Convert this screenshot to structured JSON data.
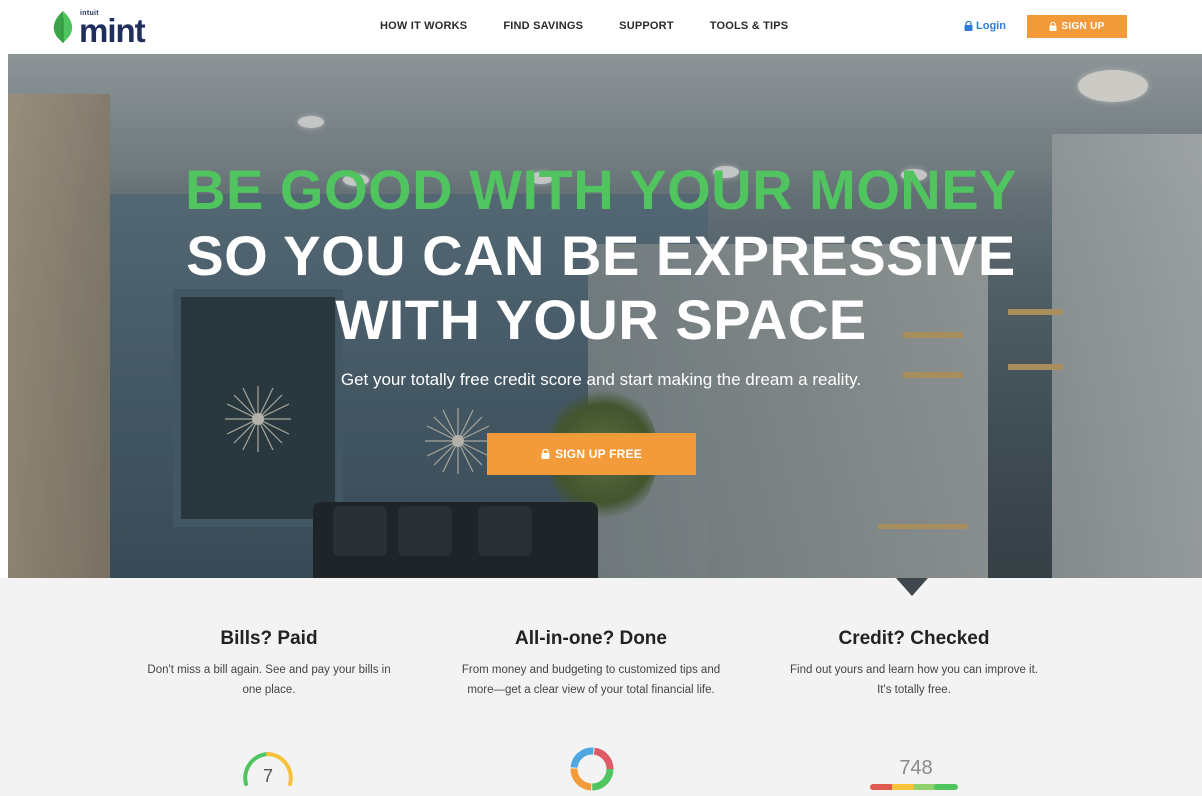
{
  "nav": {
    "logo_intuit": "intuit",
    "logo_word": "mint",
    "links": [
      "HOW IT WORKS",
      "FIND SAVINGS",
      "SUPPORT",
      "TOOLS & TIPS"
    ],
    "login_label": "Login",
    "signup_label": "SIGN UP"
  },
  "hero": {
    "headline_green": "BE GOOD WITH YOUR MONEY",
    "headline_line2": "SO YOU CAN BE EXPRESSIVE",
    "headline_line3": "WITH YOUR SPACE",
    "subtitle": "Get your totally free credit score and start making the dream a reality.",
    "cta_label": "SIGN UP FREE"
  },
  "features": [
    {
      "title": "Bills? Paid",
      "description": "Don't miss a bill again. See and pay your bills in one place.",
      "icon": "bill-gauge-icon",
      "icon_value": "7"
    },
    {
      "title": "All-in-one? Done",
      "description": "From money and budgeting to customized tips and more—get a clear view of your total financial life.",
      "icon": "donut-chart-icon"
    },
    {
      "title": "Credit? Checked",
      "description": "Find out yours and learn how you can improve it. It's totally free.",
      "icon": "credit-score-icon",
      "icon_value": "748"
    }
  ],
  "colors": {
    "brand_green": "#4fc45f",
    "accent_orange": "#f39a3a",
    "login_blue": "#2f7bd8",
    "navy": "#1f2e5c"
  }
}
